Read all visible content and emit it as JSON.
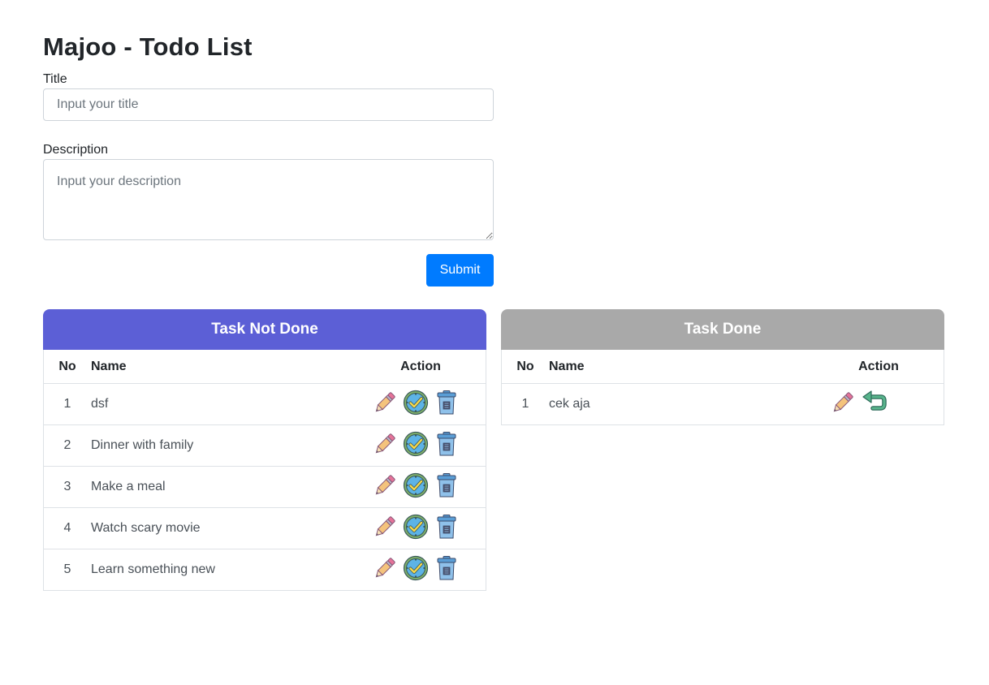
{
  "app": {
    "title": "Majoo - Todo List"
  },
  "form": {
    "title_label": "Title",
    "title_placeholder": "Input your title",
    "description_label": "Description",
    "description_placeholder": "Input your description",
    "submit_label": "Submit"
  },
  "not_done": {
    "header": "Task Not Done",
    "header_color": "#5c5fd6",
    "columns": {
      "no": "No",
      "name": "Name",
      "action": "Action"
    },
    "rows": [
      {
        "no": "1",
        "name": "dsf"
      },
      {
        "no": "2",
        "name": "Dinner with family"
      },
      {
        "no": "3",
        "name": "Make a meal"
      },
      {
        "no": "4",
        "name": "Watch scary movie"
      },
      {
        "no": "5",
        "name": "Learn something new"
      }
    ],
    "row_actions": [
      "pencil-icon",
      "check-clock-icon",
      "trash-icon"
    ]
  },
  "done": {
    "header": "Task Done",
    "header_color": "#a9a9a9",
    "columns": {
      "no": "No",
      "name": "Name",
      "action": "Action"
    },
    "rows": [
      {
        "no": "1",
        "name": "cek aja"
      }
    ],
    "row_actions": [
      "pencil-icon",
      "undo-icon"
    ]
  }
}
